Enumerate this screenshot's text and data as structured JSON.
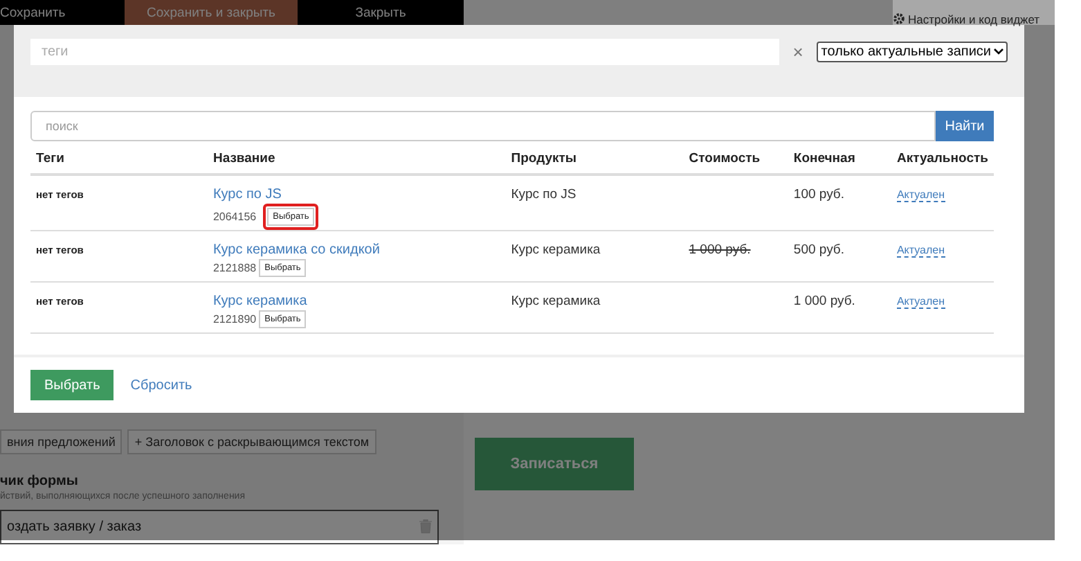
{
  "editor": {
    "toolbar": [
      {
        "label": "Сохранить",
        "kind": "plain"
      },
      {
        "label": "Сохранить и закрыть",
        "kind": "accent"
      },
      {
        "label": "Закрыть",
        "kind": "plain"
      }
    ],
    "blocks_row": [
      {
        "label": "вния предложений"
      },
      {
        "label": "+ Заголовок с раскрывающимся текстом"
      }
    ],
    "section_title": "чик формы",
    "section_hint": "йствий, выполняющихся после успешного заполнения",
    "action": "оздать заявку / заказ",
    "settings_link": "Настройки и код виджет",
    "submit_button": "Записаться"
  },
  "modal": {
    "tags_field": {
      "placeholder": "теги"
    },
    "clear": "×",
    "filter_select": "только актуальные записи",
    "search": {
      "placeholder": "поиск"
    },
    "search_button": "Найти",
    "columns": [
      "Теги",
      "Название",
      "Продукты",
      "Стоимость",
      "Конечная",
      "Актуальность"
    ],
    "rows": [
      {
        "tags": "нет тегов",
        "title": "Курс по JS",
        "id": "2064156",
        "pick": "Выбрать",
        "highlighted": true,
        "products": "Курс по JS",
        "price": "",
        "final": "100 руб.",
        "status": "Актуален"
      },
      {
        "tags": "нет тегов",
        "title": "Курс керамика со скидкой",
        "id": "2121888",
        "pick": "Выбрать",
        "highlighted": false,
        "products": "Курс керамика",
        "price": "1 000 руб.",
        "final": "500 руб.",
        "status": "Актуален"
      },
      {
        "tags": "нет тегов",
        "title": "Курс керамика",
        "id": "2121890",
        "pick": "Выбрать",
        "highlighted": false,
        "products": "Курс керамика",
        "price": "",
        "final": "1 000 руб.",
        "status": "Актуален"
      }
    ],
    "select_button": "Выбрать",
    "reset_link": "Сбросить"
  }
}
